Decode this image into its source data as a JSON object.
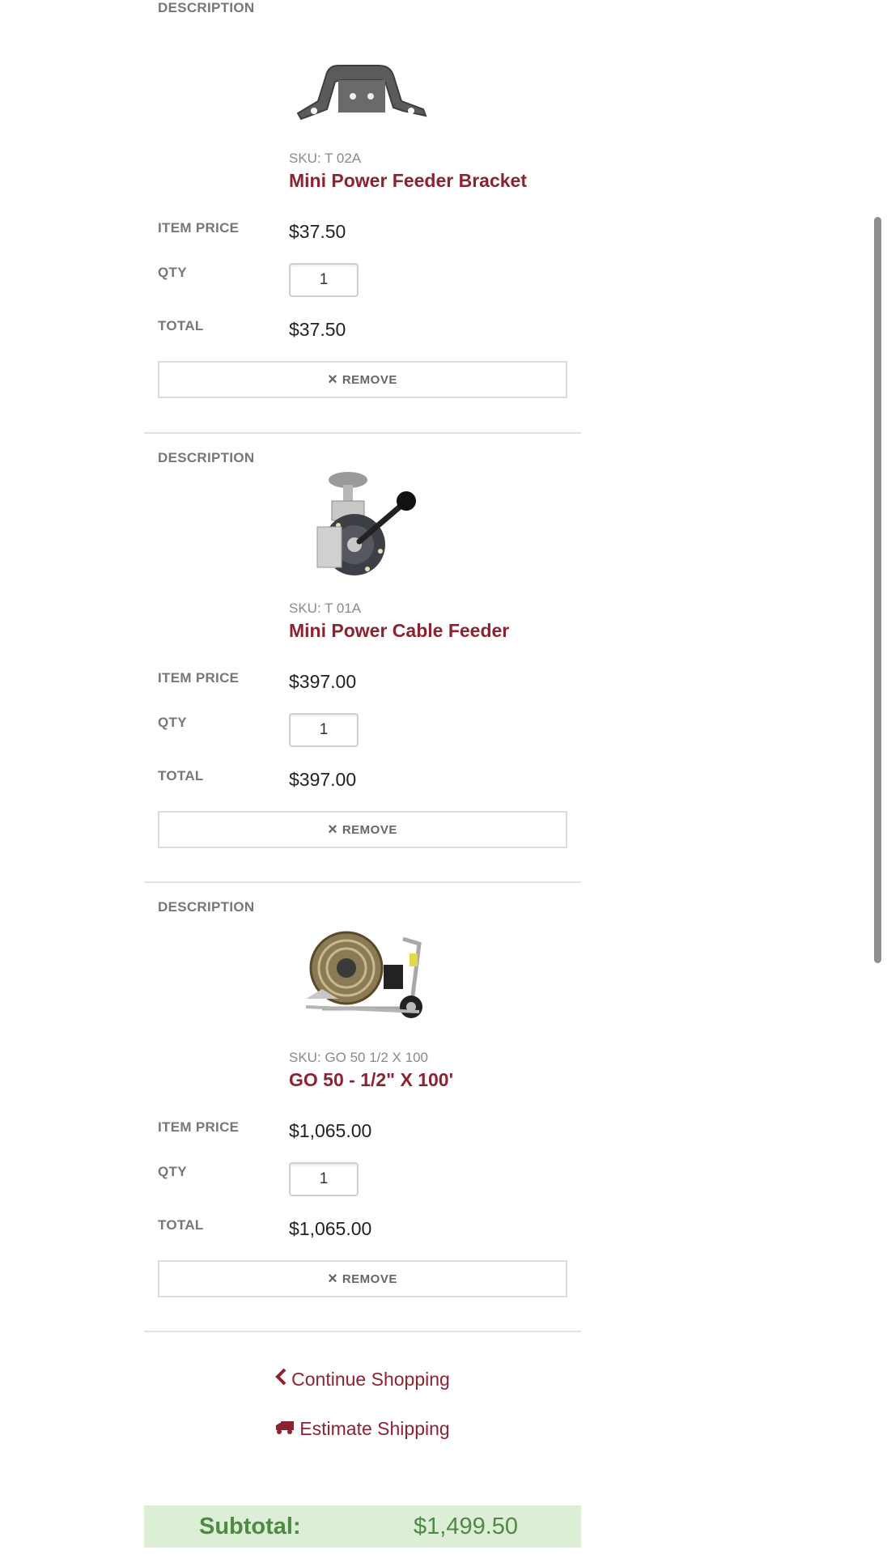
{
  "labels": {
    "description": "DESCRIPTION",
    "item_price": "ITEM PRICE",
    "qty": "QTY",
    "total": "TOTAL",
    "remove": "REMOVE"
  },
  "items": [
    {
      "sku": "SKU: T 02A",
      "name": "Mini Power Feeder Bracket",
      "image_icon": "bracket-image",
      "price": "$37.50",
      "qty": "1",
      "total": "$37.50"
    },
    {
      "sku": "SKU: T 01A",
      "name": "Mini Power Cable Feeder",
      "image_icon": "cable-feeder-image",
      "price": "$397.00",
      "qty": "1",
      "total": "$397.00"
    },
    {
      "sku": "SKU: GO 50 1/2 X 100",
      "name": "GO 50 - 1/2\" X 100'",
      "image_icon": "drain-machine-image",
      "price": "$1,065.00",
      "qty": "1",
      "total": "$1,065.00"
    }
  ],
  "actions": {
    "continue_shopping": "Continue Shopping",
    "estimate_shipping": "Estimate Shipping"
  },
  "summary": {
    "subtotal_label": "Subtotal:",
    "subtotal_value": "$1,499.50"
  },
  "colors": {
    "product_link": "#8b2330",
    "subtotal_bg": "#dceed5",
    "subtotal_text": "#4f8a44"
  }
}
